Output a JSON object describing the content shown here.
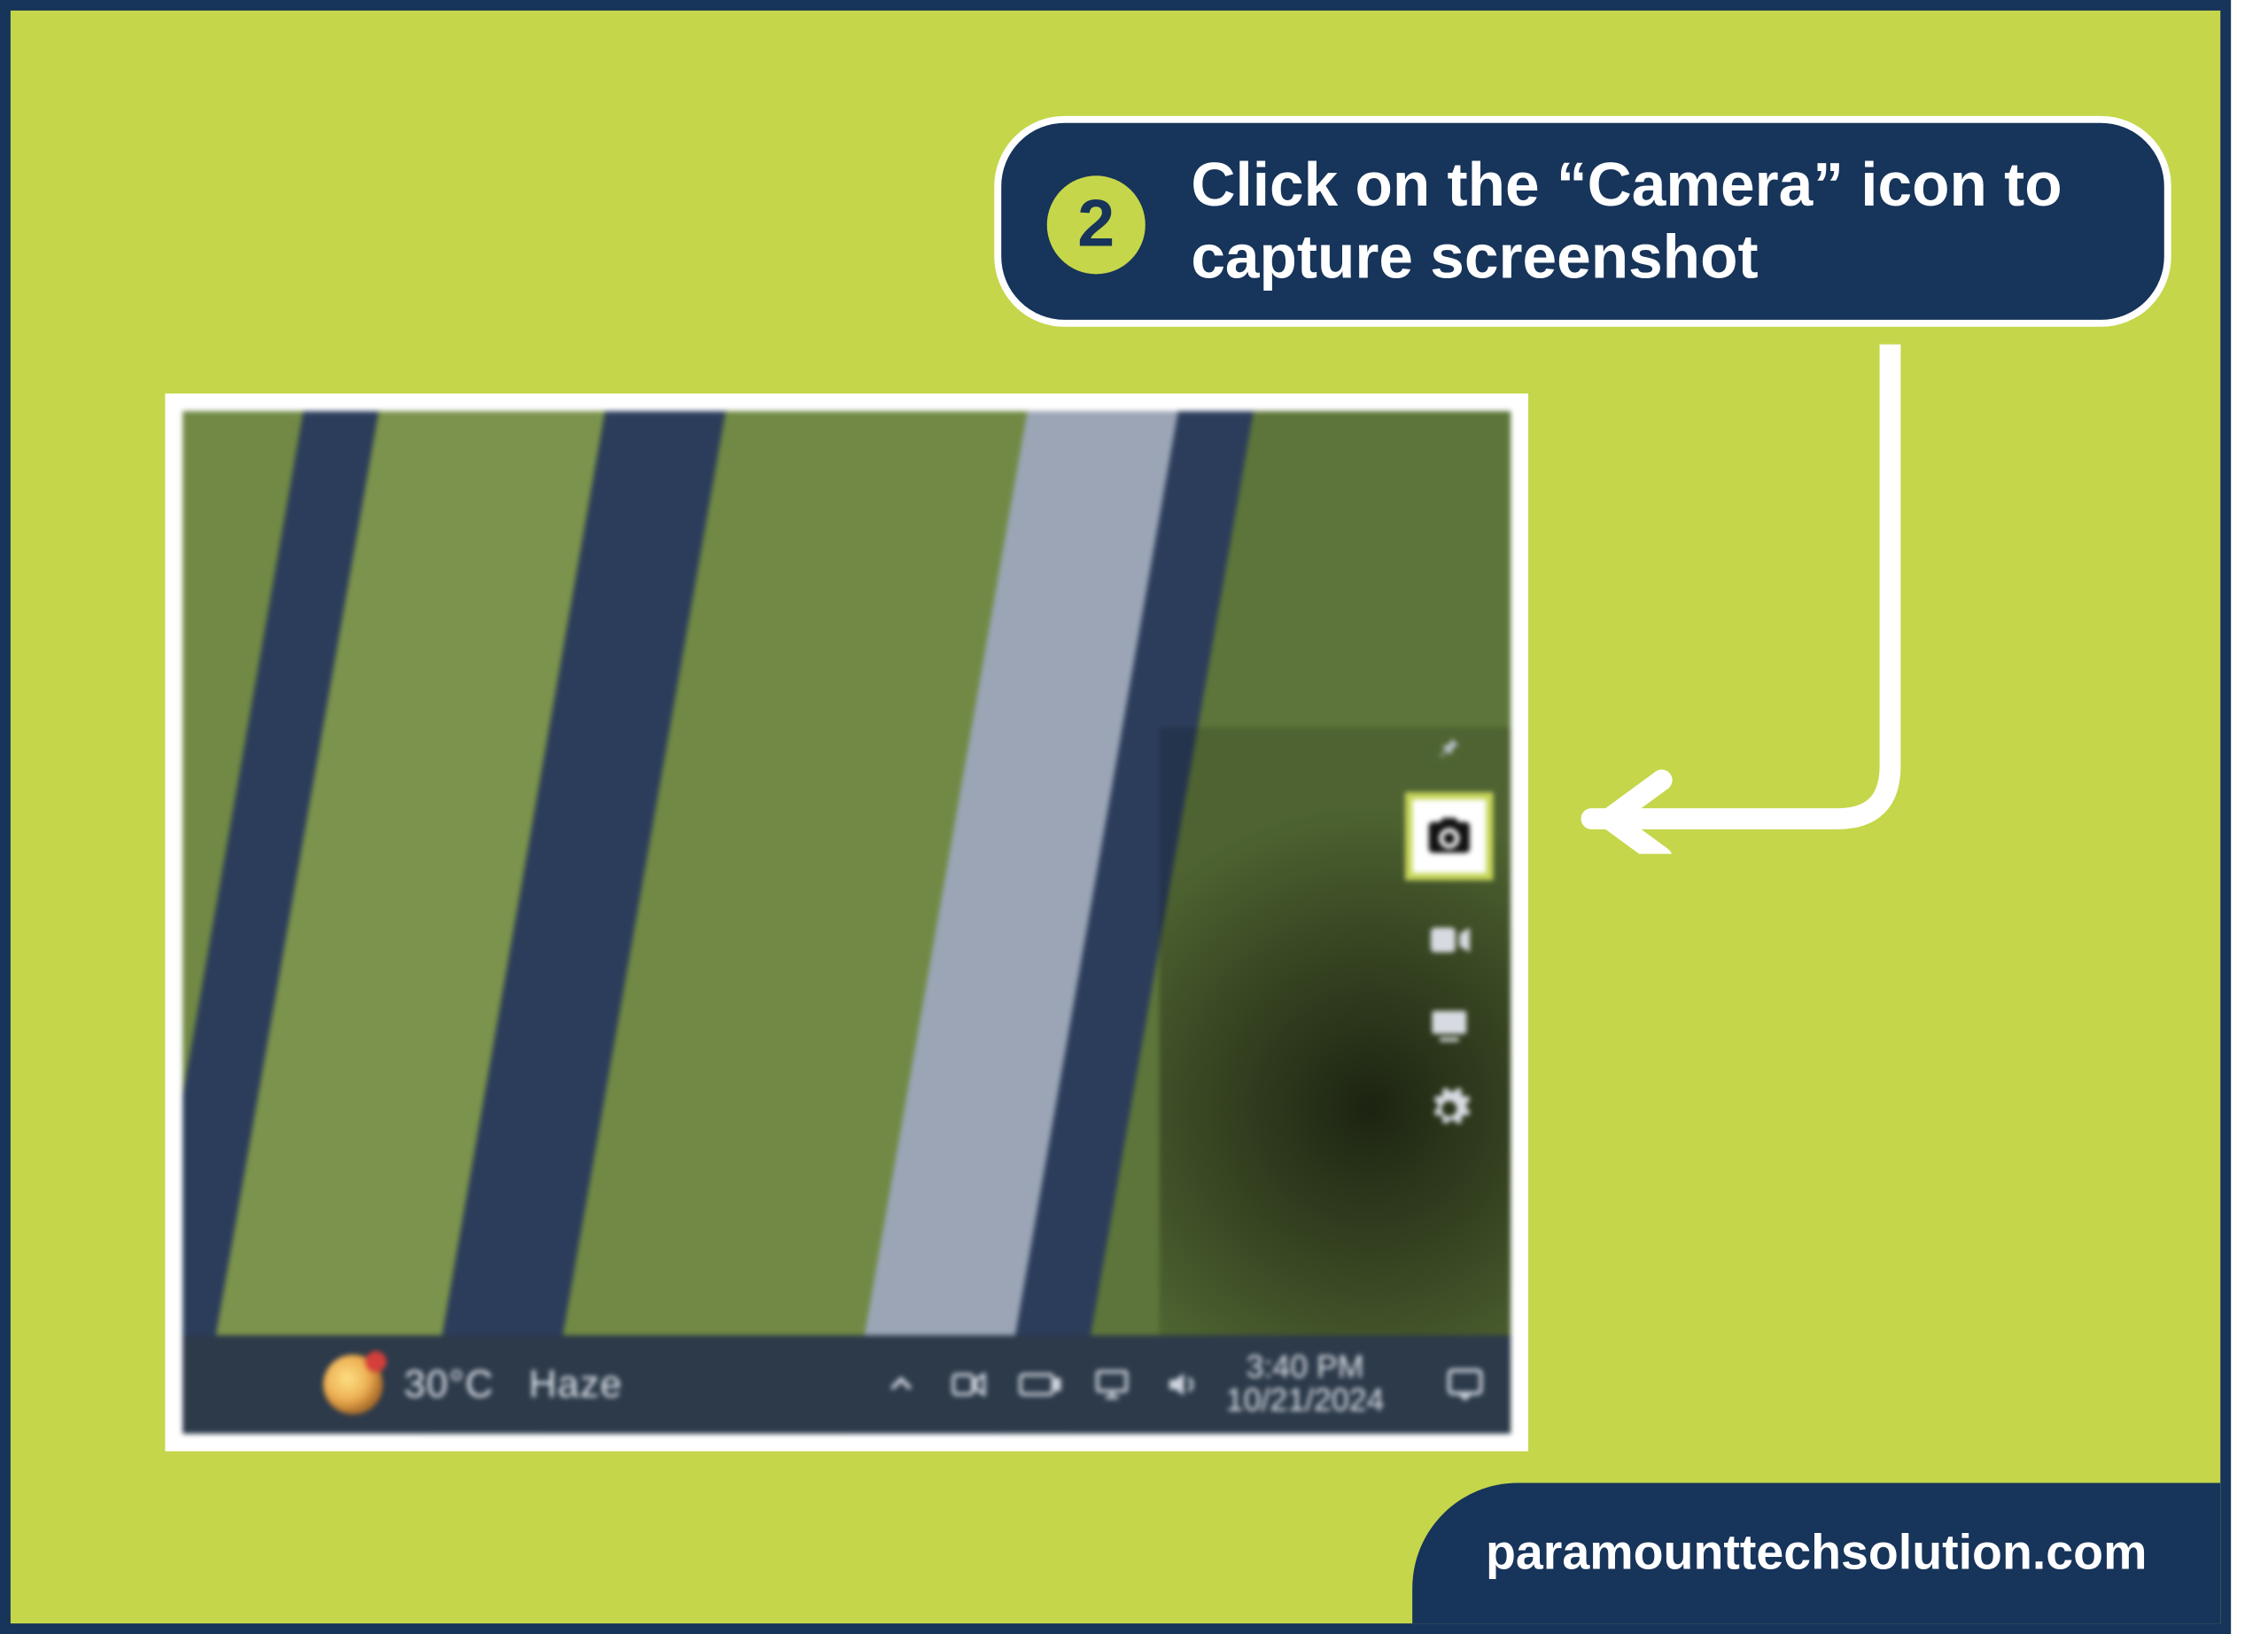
{
  "callout": {
    "step_number": "2",
    "text": "Click on the “Camera” icon to capture screenshot"
  },
  "screenshot": {
    "gamebar": {
      "pin": "pin",
      "camera": "camera",
      "video": "video",
      "broadcast": "broadcast",
      "settings": "settings"
    },
    "taskbar": {
      "weather_temp": "30°C",
      "weather_cond": "Haze",
      "tray": {
        "chevron": "chevron-up",
        "meet": "meet-now",
        "battery": "battery",
        "network": "network",
        "volume": "volume"
      },
      "time": "3:40 PM",
      "date": "10/21/2024",
      "action_center": "action-center"
    }
  },
  "footer": {
    "site": "paramounttechsolution.com"
  },
  "colors": {
    "bg": "#c5d64a",
    "navy": "#17345a",
    "white": "#ffffff"
  }
}
